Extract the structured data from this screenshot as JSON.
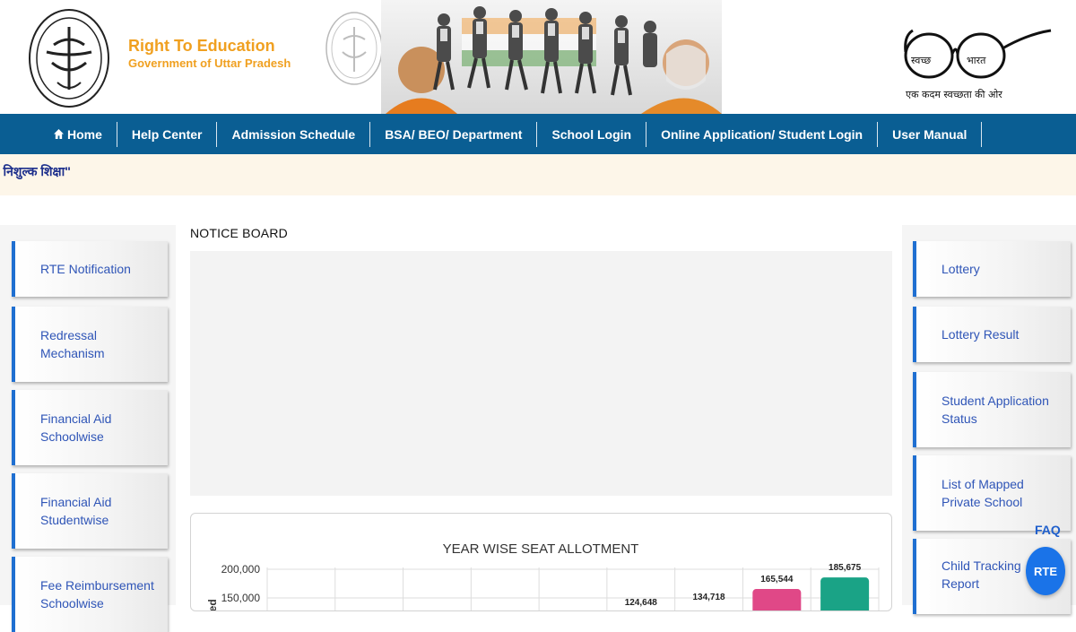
{
  "brand": {
    "title": "Right To Education",
    "subtitle": "Government of Uttar Pradesh"
  },
  "logos": {
    "emblem_icon": "up-govt-emblem-icon",
    "banner_icon": "students-banner-image",
    "swachh_icon": "swachh-bharat-logo-icon",
    "swachh_tagline": "एक कदम स्वच्छता की ओर",
    "swachh_left": "स्वच्छ",
    "swachh_right": "भारत"
  },
  "nav": {
    "items": [
      {
        "label": "Home",
        "icon": "home-icon"
      },
      {
        "label": "Help Center"
      },
      {
        "label": "Admission Schedule"
      },
      {
        "label": "BSA/ BEO/ Department"
      },
      {
        "label": "School Login"
      },
      {
        "label": "Online Application/ Student Login"
      },
      {
        "label": "User Manual"
      }
    ]
  },
  "ticker": {
    "text": "\" निशुल्क शिक्षा\""
  },
  "left_menu": [
    {
      "line1": "RTE Notification",
      "line2": ""
    },
    {
      "line1": "Redressal",
      "line2": "Mechanism"
    },
    {
      "line1": "Financial Aid",
      "line2": "Schoolwise"
    },
    {
      "line1": "Financial Aid",
      "line2": "Studentwise"
    },
    {
      "line1": "Fee Reimbursement",
      "line2": "Schoolwise"
    }
  ],
  "right_menu": [
    {
      "line1": "Lottery",
      "line2": ""
    },
    {
      "line1": "Lottery Result",
      "line2": ""
    },
    {
      "line1": "Student Application",
      "line2": "Status"
    },
    {
      "line1": "List of Mapped",
      "line2": "Private School"
    },
    {
      "line1": "Child Tracking",
      "line2": "Report"
    }
  ],
  "notice": {
    "title": "NOTICE BOARD"
  },
  "chart_data": {
    "type": "bar",
    "title": "YEAR WISE SEAT ALLOTMENT",
    "ylabel": "Allotted",
    "ylim": [
      0,
      200000
    ],
    "yticks": [
      "200,000",
      "150,000"
    ],
    "categories": [
      "",
      "",
      "",
      "",
      "",
      "",
      "",
      "",
      ""
    ],
    "values": [
      null,
      null,
      null,
      null,
      null,
      124648,
      134718,
      165544,
      185675
    ],
    "value_labels": [
      "",
      "",
      "",
      "",
      "",
      "124,648",
      "134,718",
      "165,544",
      "185,675"
    ],
    "bar_colors": [
      "",
      "",
      "",
      "",
      "",
      "",
      "",
      "#e04887",
      "#1aa386"
    ],
    "grid": true
  },
  "floating": {
    "faq": "FAQ",
    "rte": "RTE"
  }
}
